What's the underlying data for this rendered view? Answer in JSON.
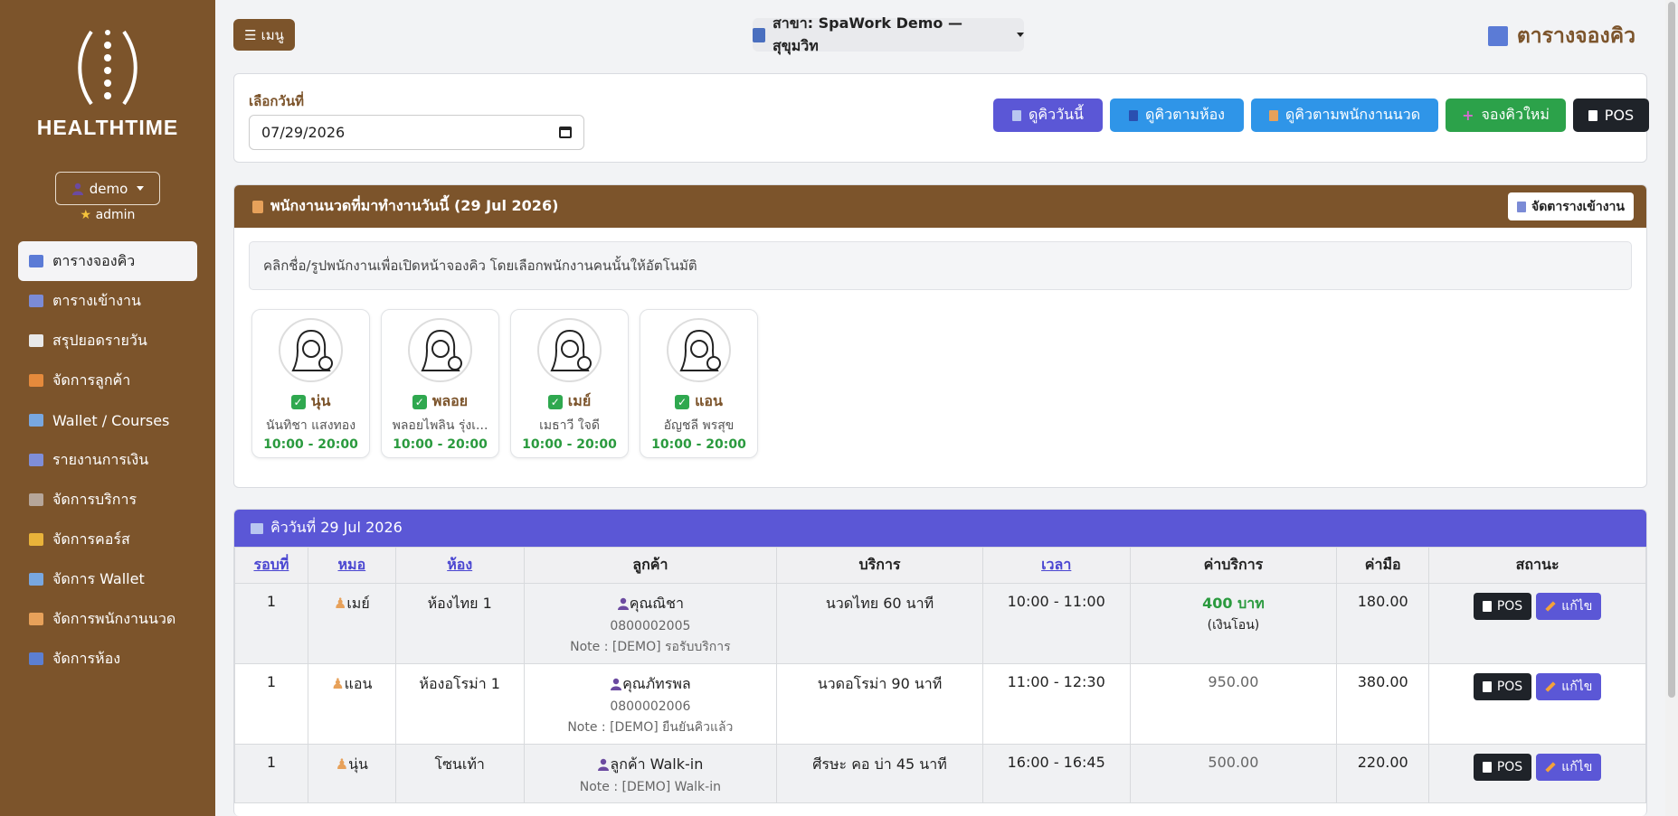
{
  "sidebar": {
    "brand": "HEALTHTIME",
    "user": "demo",
    "role": "admin",
    "items": [
      {
        "label": "ตารางจองคิว",
        "icon": "calendar-icon",
        "color": "#5b7bd6",
        "active": true
      },
      {
        "label": "ตารางเข้างาน",
        "icon": "calendar-icon",
        "color": "#7b8bd6"
      },
      {
        "label": "สรุปยอดรายวัน",
        "icon": "receipt-icon",
        "color": "#e9e9e9"
      },
      {
        "label": "จัดการลูกค้า",
        "icon": "massage-icon",
        "color": "#e58a3c"
      },
      {
        "label": "Wallet /  Courses",
        "icon": "wallet-icon",
        "color": "#78a7e0"
      },
      {
        "label": "รายงานการเงิน",
        "icon": "chart-icon",
        "color": "#7f8ed8"
      },
      {
        "label": "จัดการบริการ",
        "icon": "stamp-icon",
        "color": "#b6a69a"
      },
      {
        "label": "จัดการคอร์ส",
        "icon": "ticket-icon",
        "color": "#e9b33a"
      },
      {
        "label": "จัดการ Wallet",
        "icon": "wallet-icon",
        "color": "#78a7e0"
      },
      {
        "label": "จัดการพนักงานนวด",
        "icon": "staff-icon",
        "color": "#e7a15a"
      },
      {
        "label": "จัดการห้อง",
        "icon": "bed-icon",
        "color": "#5c7fd1"
      }
    ]
  },
  "header": {
    "menu_label": "เมนู",
    "branch_label": "สาขา: SpaWork Demo — สุขุมวิท",
    "page_title": "ตารางจองคิว"
  },
  "date_card": {
    "label": "เลือกวันที่",
    "value": "07/29/2026",
    "buttons": [
      {
        "label": "ดูคิววันนี้",
        "color": "#5b57d6"
      },
      {
        "label": "ดูคิวตามห้อง",
        "color": "#2f95e8"
      },
      {
        "label": "ดูคิวตามพนักงานนวด",
        "color": "#2f95e8"
      },
      {
        "label": "จองคิวใหม่",
        "color": "#2ca24a"
      },
      {
        "label": "POS",
        "color": "#1f2329"
      }
    ]
  },
  "staff_card": {
    "title": "พนักงานนวดที่มาทำงานวันนี้ (29 Jul 2026)",
    "schedule_button": "จัดตารางเข้างาน",
    "hint": "คลิกชื่อ/รูปพนักงานเพื่อเปิดหน้าจองคิว โดยเลือกพนักงานคนนั้นให้อัตโนมัติ",
    "staff": [
      {
        "nick": "นุ่น",
        "name": "นันทิชา แสงทอง",
        "hours": "10:00 - 20:00"
      },
      {
        "nick": "พลอย",
        "name": "พลอยไพลิน รุ่งเ...",
        "hours": "10:00 - 20:00"
      },
      {
        "nick": "เมย์",
        "name": "เมธาวี ใจดี",
        "hours": "10:00 - 20:00"
      },
      {
        "nick": "แอน",
        "name": "อัญชลี พรสุข",
        "hours": "10:00 - 20:00"
      }
    ]
  },
  "queue": {
    "title": "คิววันที่ 29 Jul 2026",
    "columns": [
      "รอบที่",
      "หมอ",
      "ห้อง",
      "ลูกค้า",
      "บริการ",
      "เวลา",
      "ค่าบริการ",
      "ค่ามือ",
      "สถานะ"
    ],
    "rows": [
      {
        "round": "1",
        "staff": "เมย์",
        "room": "ห้องไทย 1",
        "customer": "คุณณิชา",
        "phone": "0800002005",
        "note": "Note : [DEMO] รอรับบริการ",
        "service": "นวดไทย 60 นาที",
        "time": "10:00 - 11:00",
        "price": "400 บาท",
        "price_sub": "(เงินโอน)",
        "tip": "180.00"
      },
      {
        "round": "1",
        "staff": "แอน",
        "room": "ห้องอโรม่า 1",
        "customer": "คุณภัทรพล",
        "phone": "0800002006",
        "note": "Note : [DEMO] ยืนยันคิวแล้ว",
        "service": "นวดอโรม่า 90 นาที",
        "time": "11:00 - 12:30",
        "price": "950.00",
        "price_sub": "",
        "tip": "380.00"
      },
      {
        "round": "1",
        "staff": "นุ่น",
        "room": "โซนเท้า",
        "customer": "ลูกค้า Walk-in",
        "phone": "",
        "note": "Note : [DEMO] Walk-in",
        "service": "ศีรษะ คอ บ่า 45 นาที",
        "time": "16:00 - 16:45",
        "price": "500.00",
        "price_sub": "",
        "tip": "220.00"
      }
    ],
    "pos_label": "POS",
    "edit_label": "แก้ไข"
  }
}
